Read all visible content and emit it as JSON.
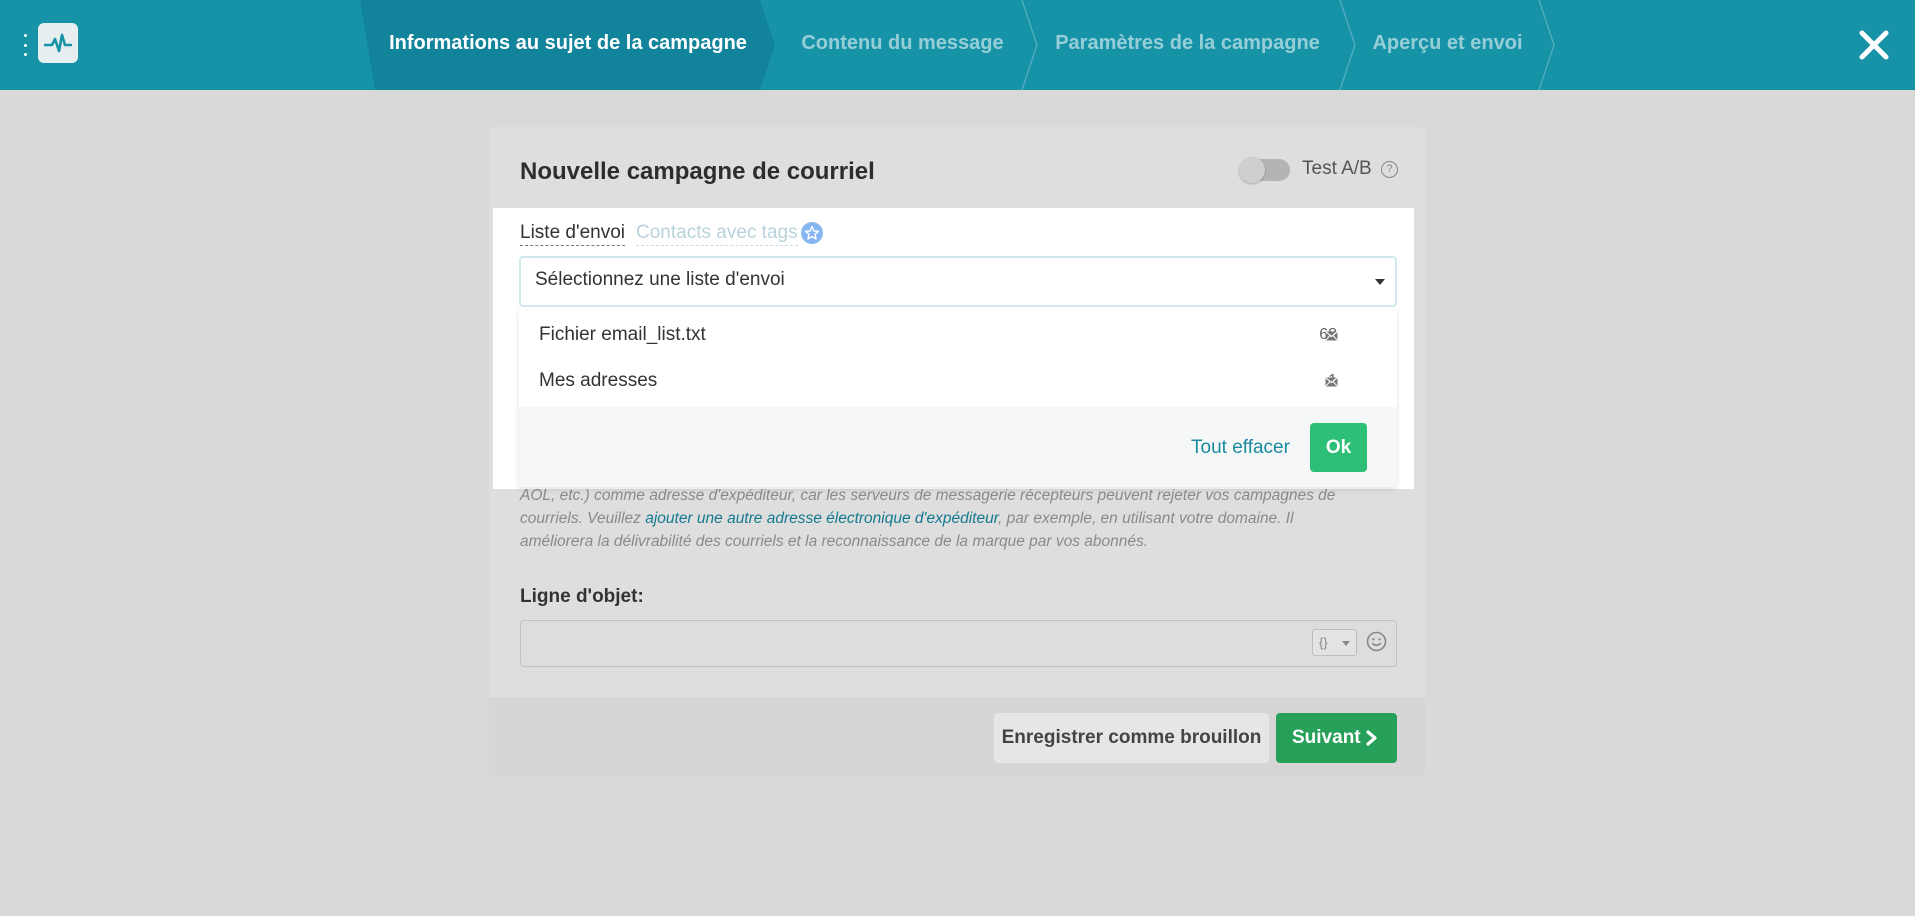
{
  "header": {
    "steps": [
      {
        "label": "Informations au sujet de la campagne",
        "active": true
      },
      {
        "label": "Contenu du message",
        "active": false
      },
      {
        "label": "Paramètres de la campagne",
        "active": false
      },
      {
        "label": "Aperçu et envoi",
        "active": false
      }
    ],
    "colors": {
      "bar": "#1793a8",
      "active_step": "#11839a"
    }
  },
  "form": {
    "title": "Nouvelle campagne de courriel",
    "ab_test_label": "Test A/B",
    "ab_test_enabled": false,
    "help_glyph": "?",
    "tabs": {
      "list": "Liste d'envoi",
      "tags": "Contacts avec tags"
    },
    "list_select": {
      "placeholder": "Sélectionnez une liste d'envoi"
    },
    "dropdown": {
      "items": [
        {
          "name": "Fichier email_list.txt",
          "count": "68"
        },
        {
          "name": "Mes adresses",
          "count": "1"
        }
      ],
      "clear_label": "Tout effacer",
      "ok_label": "Ok"
    },
    "notice": {
      "line_start": "AOL, etc.) comme adresse d'expéditeur, car les serveurs de messagerie récepteurs peuvent rejeter vos campagnes de courriels. Veuillez ",
      "link": "ajouter une autre adresse électronique d'expéditeur",
      "line_end": ", par exemple, en utilisant votre domaine. Il améliorera la délivrabilité des courriels et la reconnaissance de la marque par vos abonnés."
    },
    "subject": {
      "label": "Ligne d'objet:",
      "value": "",
      "var_button": "{}"
    }
  },
  "actions": {
    "draft_label": "Enregistrer comme brouillon",
    "next_label": "Suivant"
  },
  "icons": [
    "menu-dots-icon",
    "pulse-logo-icon",
    "close-icon",
    "help-icon",
    "star-icon",
    "envelope-icon",
    "emoji-icon",
    "chevron-right-icon"
  ]
}
